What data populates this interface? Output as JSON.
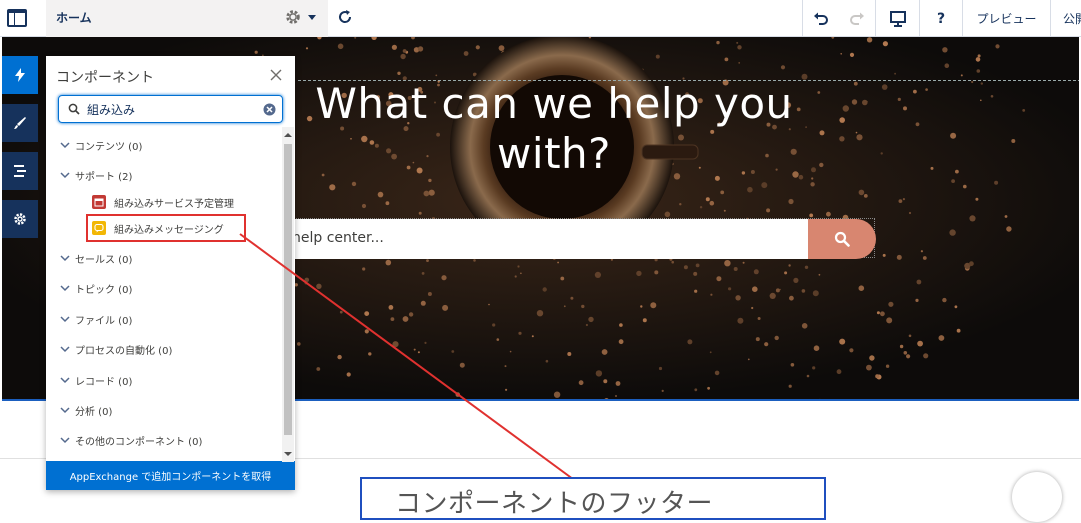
{
  "topbar": {
    "page_name": "ホーム",
    "preview_label": "プレビュー",
    "publish_label": "公開",
    "help_label": "?"
  },
  "hero": {
    "title": "What can we help you with?",
    "search_placeholder": "help center..."
  },
  "panel": {
    "title": "コンポーネント",
    "search_value": "組み込み",
    "categories": [
      {
        "label": "コンテンツ (0)"
      },
      {
        "label": "サポート (2)"
      },
      {
        "label": "セールス (0)"
      },
      {
        "label": "トピック (0)"
      },
      {
        "label": "ファイル (0)"
      },
      {
        "label": "プロセスの自動化 (0)"
      },
      {
        "label": "レコード (0)"
      },
      {
        "label": "分析 (0)"
      },
      {
        "label": "その他のコンポーネント (0)"
      }
    ],
    "support_items": [
      {
        "label": "組み込みサービス予定管理",
        "icon": "calendar-icon",
        "color": "#c23934"
      },
      {
        "label": "組み込みメッセージング",
        "icon": "chat-icon",
        "color": "#f2b705"
      }
    ],
    "appexchange_label": "AppExchange で追加コンポーネントを取得"
  },
  "annotation": {
    "callout_text": "コンポーネントのフッター"
  },
  "colors": {
    "brand": "#0070d2",
    "rail": "#16325c",
    "search_button": "#d88670",
    "highlight": "#e0312f",
    "callout_border": "#1f4fbf"
  }
}
